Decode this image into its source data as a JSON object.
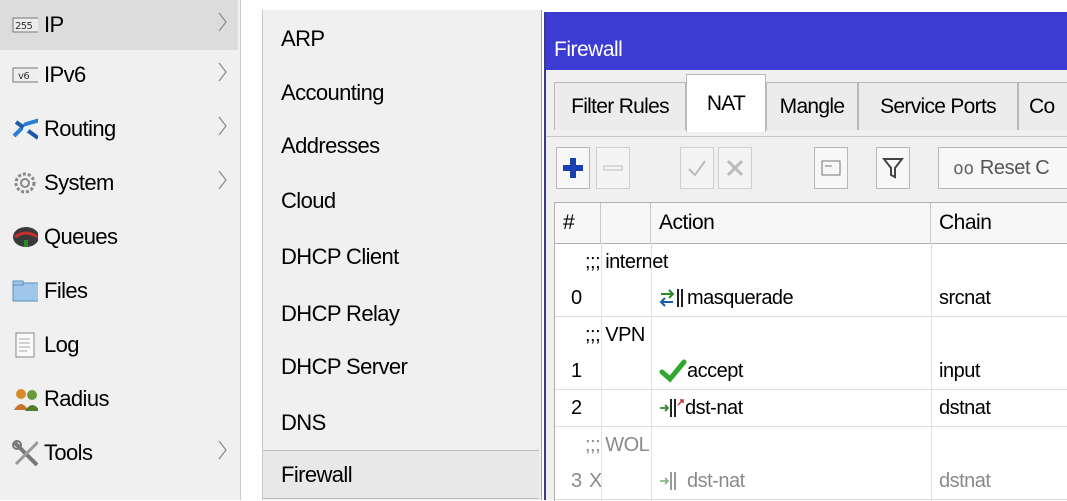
{
  "main_menu": {
    "items": [
      {
        "label": "IP",
        "icon": "ip-icon",
        "has_submenu": true,
        "selected": true
      },
      {
        "label": "IPv6",
        "icon": "ipv6-icon",
        "has_submenu": true
      },
      {
        "label": "Routing",
        "icon": "routing-icon",
        "has_submenu": true
      },
      {
        "label": "System",
        "icon": "gear-icon",
        "has_submenu": true
      },
      {
        "label": "Queues",
        "icon": "queues-icon",
        "has_submenu": false
      },
      {
        "label": "Files",
        "icon": "folder-icon",
        "has_submenu": false
      },
      {
        "label": "Log",
        "icon": "log-icon",
        "has_submenu": false
      },
      {
        "label": "Radius",
        "icon": "radius-icon",
        "has_submenu": false
      },
      {
        "label": "Tools",
        "icon": "tools-icon",
        "has_submenu": true
      }
    ],
    "ip_badge": "255",
    "ipv6_badge": "v6"
  },
  "sub_menu": {
    "items": [
      {
        "label": "ARP"
      },
      {
        "label": "Accounting"
      },
      {
        "label": "Addresses"
      },
      {
        "label": "Cloud"
      },
      {
        "label": "DHCP Client"
      },
      {
        "label": "DHCP Relay"
      },
      {
        "label": "DHCP Server"
      },
      {
        "label": "DNS"
      },
      {
        "label": "Firewall",
        "selected": true
      }
    ]
  },
  "window": {
    "title": "Firewall",
    "tabs": [
      {
        "label": "Filter Rules"
      },
      {
        "label": "NAT",
        "active": true
      },
      {
        "label": "Mangle"
      },
      {
        "label": "Service Ports"
      },
      {
        "label": "Co"
      }
    ],
    "toolbar": {
      "add": "add-icon",
      "remove": "remove-icon",
      "enable": "check-icon",
      "disable": "cross-icon",
      "comment": "comment-icon",
      "filter": "filter-icon",
      "reset_prefix": "oo",
      "reset_label": "Reset C"
    },
    "columns": [
      "#",
      "Action",
      "Chain"
    ],
    "rows": [
      {
        "type": "comment",
        "text": ";;; internet"
      },
      {
        "type": "rule",
        "num": "0",
        "flag": "",
        "action": "masquerade",
        "action_icon": "masquerade-icon",
        "chain": "srcnat"
      },
      {
        "type": "comment",
        "text": ";;; VPN"
      },
      {
        "type": "rule",
        "num": "1",
        "flag": "",
        "action": "accept",
        "action_icon": "accept-check-icon",
        "chain": "input"
      },
      {
        "type": "rule",
        "num": "2",
        "flag": "",
        "action": "dst-nat",
        "action_icon": "dstnat-icon",
        "chain": "dstnat"
      },
      {
        "type": "comment",
        "text": ";;; WOL",
        "disabled": true
      },
      {
        "type": "rule",
        "num": "3",
        "flag": "X",
        "action": "dst-nat",
        "action_icon": "dstnat-icon",
        "chain": "dstnat",
        "disabled": true
      }
    ],
    "colors": {
      "titlebar": "#3c3cd4",
      "accept_green": "#2fa82f",
      "add_blue": "#1a3fb0"
    }
  }
}
